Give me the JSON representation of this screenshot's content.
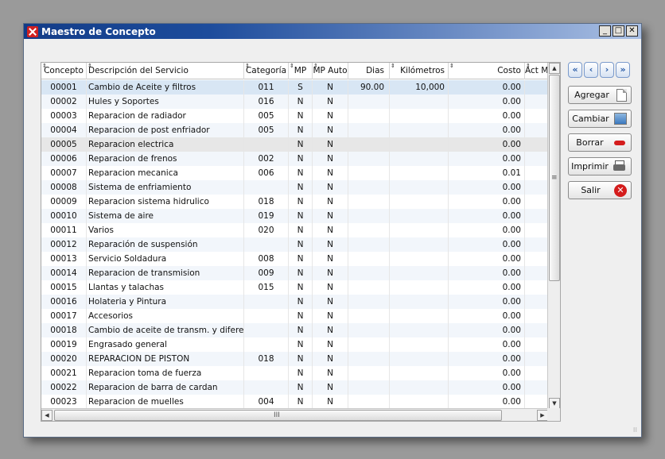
{
  "window": {
    "title": "Maestro de Concepto",
    "controls": {
      "minimize": "_",
      "maximize": "□",
      "close": "✕"
    }
  },
  "table": {
    "columns": [
      "Concepto",
      "Descripción del Servicio",
      "Categoría",
      "MP",
      "MP Auto",
      "Dias",
      "Kilómetros",
      "Costo",
      "Act M"
    ],
    "rows": [
      [
        "00001",
        "Cambio de Aceite y filtros",
        "011",
        "S",
        "N",
        "90.00",
        "10,000",
        "0.00",
        ""
      ],
      [
        "00002",
        "Hules y Soportes",
        "016",
        "N",
        "N",
        "",
        "",
        "0.00",
        ""
      ],
      [
        "00003",
        "Reparacion de radiador",
        "005",
        "N",
        "N",
        "",
        "",
        "0.00",
        ""
      ],
      [
        "00004",
        "Reparacion de post enfriador",
        "005",
        "N",
        "N",
        "",
        "",
        "0.00",
        ""
      ],
      [
        "00005",
        "Reparacion electrica",
        "",
        "N",
        "N",
        "",
        "",
        "0.00",
        ""
      ],
      [
        "00006",
        "Reparacion de frenos",
        "002",
        "N",
        "N",
        "",
        "",
        "0.00",
        ""
      ],
      [
        "00007",
        "Reparacion mecanica",
        "006",
        "N",
        "N",
        "",
        "",
        "0.01",
        ""
      ],
      [
        "00008",
        "Sistema de enfriamiento",
        "",
        "N",
        "N",
        "",
        "",
        "0.00",
        ""
      ],
      [
        "00009",
        "Reparacion sistema hidrulico",
        "018",
        "N",
        "N",
        "",
        "",
        "0.00",
        ""
      ],
      [
        "00010",
        "Sistema de aire",
        "019",
        "N",
        "N",
        "",
        "",
        "0.00",
        ""
      ],
      [
        "00011",
        "Varios",
        "020",
        "N",
        "N",
        "",
        "",
        "0.00",
        ""
      ],
      [
        "00012",
        "Reparación de suspensión",
        "",
        "N",
        "N",
        "",
        "",
        "0.00",
        ""
      ],
      [
        "00013",
        "Servicio Soldadura",
        "008",
        "N",
        "N",
        "",
        "",
        "0.00",
        ""
      ],
      [
        "00014",
        "Reparacion de transmision",
        "009",
        "N",
        "N",
        "",
        "",
        "0.00",
        ""
      ],
      [
        "00015",
        "Llantas y talachas",
        "015",
        "N",
        "N",
        "",
        "",
        "0.00",
        ""
      ],
      [
        "00016",
        "Holateria y Pintura",
        "",
        "N",
        "N",
        "",
        "",
        "0.00",
        ""
      ],
      [
        "00017",
        "Accesorios",
        "",
        "N",
        "N",
        "",
        "",
        "0.00",
        ""
      ],
      [
        "00018",
        "Cambio de aceite de transm. y diferenc",
        "",
        "N",
        "N",
        "",
        "",
        "0.00",
        ""
      ],
      [
        "00019",
        "Engrasado general",
        "",
        "N",
        "N",
        "",
        "",
        "0.00",
        ""
      ],
      [
        "00020",
        "REPARACION DE PISTON",
        "018",
        "N",
        "N",
        "",
        "",
        "0.00",
        ""
      ],
      [
        "00021",
        "Reparacion toma de fuerza",
        "",
        "N",
        "N",
        "",
        "",
        "0.00",
        ""
      ],
      [
        "00022",
        "Reparacion de barra de cardan",
        "",
        "N",
        "N",
        "",
        "",
        "0.00",
        ""
      ],
      [
        "00023",
        "Reparacion de muelles",
        "004",
        "N",
        "N",
        "",
        "",
        "0.00",
        ""
      ]
    ],
    "selected_row": 0,
    "highlighted_row": 4,
    "scroll_grip": "III"
  },
  "nav_buttons": [
    {
      "icon": "first-record-icon",
      "glyph": "«"
    },
    {
      "icon": "previous-record-icon",
      "glyph": "‹"
    },
    {
      "icon": "next-record-icon",
      "glyph": "›"
    },
    {
      "icon": "last-record-icon",
      "glyph": "»"
    }
  ],
  "actions": [
    {
      "name": "add-button",
      "label": "Agregar",
      "icon": "new-page-icon"
    },
    {
      "name": "edit-button",
      "label": "Cambiar",
      "icon": "edit-image-icon"
    },
    {
      "name": "delete-button",
      "label": "Borrar",
      "icon": "delete-icon"
    },
    {
      "name": "print-button",
      "label": "Imprimir",
      "icon": "printer-icon"
    },
    {
      "name": "exit-button",
      "label": "Salir",
      "icon": "close-circle-icon"
    }
  ],
  "colors": {
    "title_start": "#123c88",
    "selected_row": "#d8e6f4",
    "delete_red": "#d41c1c"
  }
}
